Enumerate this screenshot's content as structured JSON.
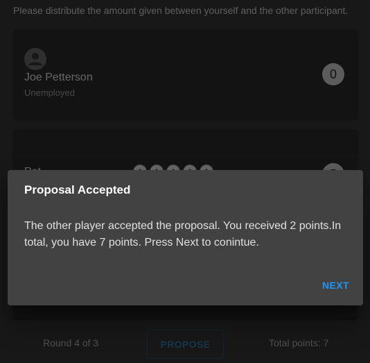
{
  "instructions": "Please distribute the amount given between yourself and the other participant.",
  "participants": [
    {
      "name": "Joe Petterson",
      "occupation": "Unemployed",
      "points": "0",
      "avatar_icon": "person-icon"
    },
    {
      "name": "Pet",
      "points": "5",
      "coins": [
        "coin",
        "coin",
        "coin",
        "coin",
        "coin"
      ]
    }
  ],
  "footer": {
    "round": "Round 4 of 3",
    "propose_label": "PROPOSE",
    "total_points": "Total points: 7"
  },
  "dialog": {
    "title": "Proposal Accepted",
    "message": "The other player accepted the proposal. You received 2 points.In total, you have 7 points. Press Next to conintue.",
    "next_label": "NEXT"
  },
  "colors": {
    "accent": "#2196f3",
    "background": "#303030",
    "card": "#262626",
    "dialog": "#424242"
  }
}
